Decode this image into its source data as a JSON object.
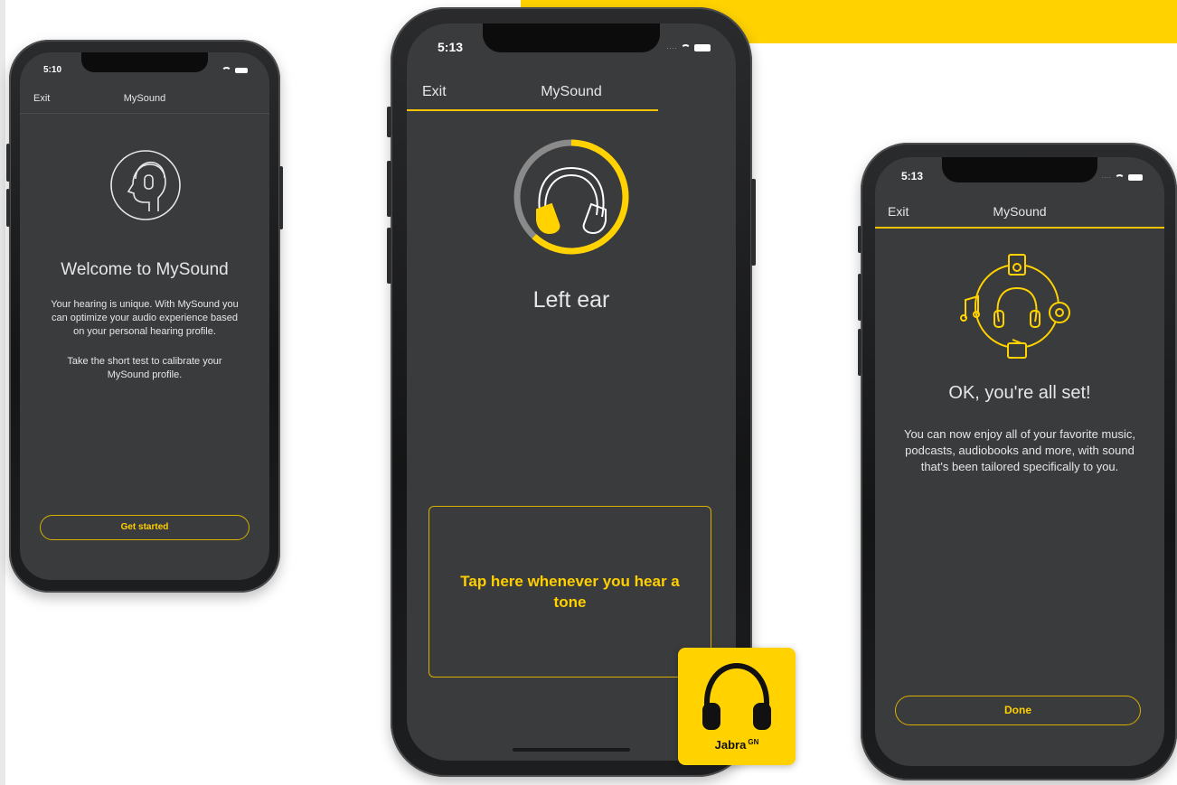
{
  "colors": {
    "accent": "#ffd200",
    "screen_bg": "#3a3b3d",
    "text": "#ffffff"
  },
  "phone_left": {
    "status_time": "5:10",
    "nav": {
      "exit": "Exit",
      "title": "MySound"
    },
    "icon": "head-with-headphones-icon",
    "heading": "Welcome to MySound",
    "body_1": "Your hearing is unique. With MySound you can optimize your audio experience based on your personal hearing profile.",
    "body_2": "Take the short test to calibrate your MySound profile.",
    "button": "Get started"
  },
  "phone_center": {
    "status_time": "5:13",
    "nav": {
      "exit": "Exit",
      "title": "MySound"
    },
    "progress": 0.62,
    "icon": "headphones-progress-icon",
    "heading": "Left ear",
    "tap_box": "Tap here whenever you hear a tone"
  },
  "phone_right": {
    "status_time": "5:13",
    "nav": {
      "exit": "Exit",
      "title": "MySound"
    },
    "icon": "headphones-media-circle-icon",
    "heading": "OK, you're all set!",
    "body": "You can now enjoy all of your favorite music, podcasts, audiobooks and more, with sound that's been tailored specifically to you.",
    "button": "Done"
  },
  "logo": {
    "brand": "Jabra",
    "suffix": "GN",
    "icon": "jabra-headphones-logo-icon"
  }
}
